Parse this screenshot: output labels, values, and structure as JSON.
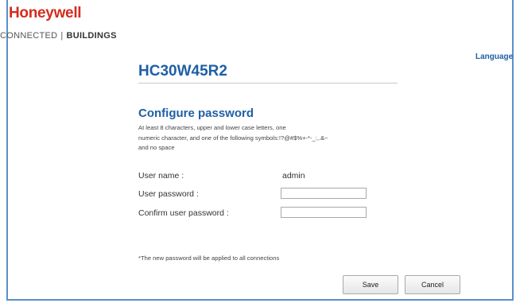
{
  "brand": {
    "logo_text": "Honeywell",
    "tagline_left": "CONNECTED",
    "tagline_sep": "|",
    "tagline_right": "BUILDINGS"
  },
  "header": {
    "language_label": "Language"
  },
  "device": {
    "model": "HC30W45R2"
  },
  "form": {
    "title": "Configure password",
    "help_lines": [
      "At least 8 characters, upper and lower case letters, one",
      "numeric character, and one of the following symbols:!?@#$%+-*-_:,.&~",
      "and no space"
    ],
    "username_label": "User name :",
    "username_value": "admin",
    "password_label": "User password :",
    "password_value": "",
    "confirm_label": "Confirm user password :",
    "confirm_value": "",
    "note": "*The new password will be applied to all connections"
  },
  "buttons": {
    "save": "Save",
    "cancel": "Cancel"
  },
  "colors": {
    "brand_red": "#d52b1e",
    "title_blue": "#1f5fa6",
    "frame_blue": "#5b8fc9"
  }
}
